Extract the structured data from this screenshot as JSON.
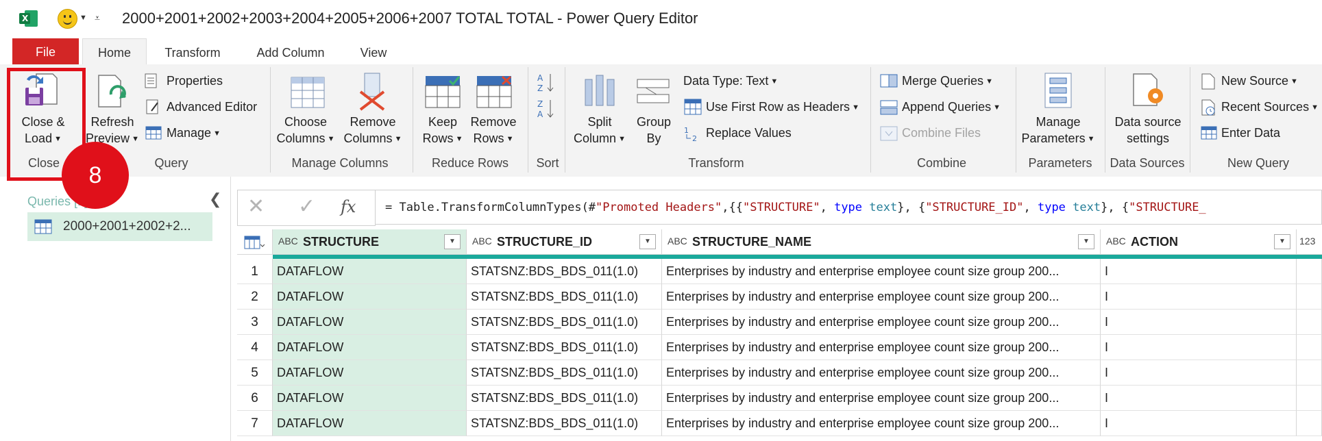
{
  "window": {
    "title": "2000+2001+2002+2003+2004+2005+2006+2007 TOTAL TOTAL - Power Query Editor"
  },
  "tabs": [
    "File",
    "Home",
    "Transform",
    "Add Column",
    "View"
  ],
  "ribbon": {
    "close_and_load": [
      "Close &",
      "Load"
    ],
    "refresh_preview": [
      "Refresh",
      "Preview"
    ],
    "properties": "Properties",
    "advanced_editor": "Advanced Editor",
    "manage": "Manage",
    "choose_columns": [
      "Choose",
      "Columns"
    ],
    "remove_columns": [
      "Remove",
      "Columns"
    ],
    "keep_rows": [
      "Keep",
      "Rows"
    ],
    "remove_rows": [
      "Remove",
      "Rows"
    ],
    "split_column": [
      "Split",
      "Column"
    ],
    "group_by": [
      "Group",
      "By"
    ],
    "data_type": "Data Type: Text",
    "use_first_row": "Use First Row as Headers",
    "replace_values": "Replace Values",
    "merge_queries": "Merge Queries",
    "append_queries": "Append Queries",
    "combine_files": "Combine Files",
    "manage_parameters": [
      "Manage",
      "Parameters"
    ],
    "data_source_settings": [
      "Data source",
      "settings"
    ],
    "new_source": "New Source",
    "recent_sources": "Recent Sources",
    "enter_data": "Enter Data",
    "groups": [
      "Close",
      "Query",
      "Manage Columns",
      "Reduce Rows",
      "Sort",
      "Transform",
      "Combine",
      "Parameters",
      "Data Sources",
      "New Query"
    ]
  },
  "annotation": {
    "badge": "8"
  },
  "queries": {
    "header": "Queries [1]",
    "items": [
      "2000+2001+2002+2..."
    ]
  },
  "formula": {
    "parts": [
      "= Table.TransformColumnTypes(#",
      "\"Promoted Headers\"",
      ",{{",
      "\"STRUCTURE\"",
      ", ",
      "type",
      " ",
      "text",
      "}, {",
      "\"STRUCTURE_ID\"",
      ", ",
      "type",
      " ",
      "text",
      "}, {",
      "\"STRUCTURE_"
    ]
  },
  "table": {
    "columns": [
      {
        "type": "ABC",
        "name": "STRUCTURE"
      },
      {
        "type": "ABC",
        "name": "STRUCTURE_ID"
      },
      {
        "type": "ABC",
        "name": "STRUCTURE_NAME"
      },
      {
        "type": "ABC",
        "name": "ACTION"
      },
      {
        "type": "123",
        "name": ""
      }
    ],
    "rows": [
      [
        "1",
        "DATAFLOW",
        "STATSNZ:BDS_BDS_011(1.0)",
        "Enterprises by industry and enterprise employee count size group 200...",
        "I"
      ],
      [
        "2",
        "DATAFLOW",
        "STATSNZ:BDS_BDS_011(1.0)",
        "Enterprises by industry and enterprise employee count size group 200...",
        "I"
      ],
      [
        "3",
        "DATAFLOW",
        "STATSNZ:BDS_BDS_011(1.0)",
        "Enterprises by industry and enterprise employee count size group 200...",
        "I"
      ],
      [
        "4",
        "DATAFLOW",
        "STATSNZ:BDS_BDS_011(1.0)",
        "Enterprises by industry and enterprise employee count size group 200...",
        "I"
      ],
      [
        "5",
        "DATAFLOW",
        "STATSNZ:BDS_BDS_011(1.0)",
        "Enterprises by industry and enterprise employee count size group 200...",
        "I"
      ],
      [
        "6",
        "DATAFLOW",
        "STATSNZ:BDS_BDS_011(1.0)",
        "Enterprises by industry and enterprise employee count size group 200...",
        "I"
      ],
      [
        "7",
        "DATAFLOW",
        "STATSNZ:BDS_BDS_011(1.0)",
        "Enterprises by industry and enterprise employee count size group 200...",
        "I"
      ]
    ]
  },
  "colors": {
    "file_tab": "#d32626",
    "accent_teal": "#1aa99b",
    "annotation_red": "#e0101a",
    "selected_col": "#d9efe3"
  }
}
